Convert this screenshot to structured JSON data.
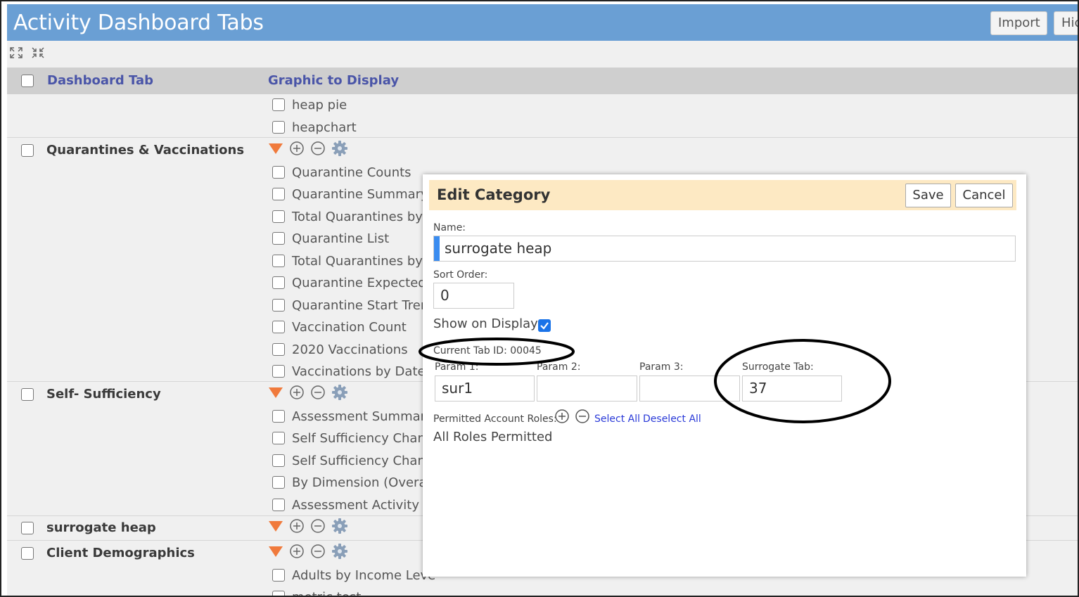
{
  "header": {
    "title": "Activity Dashboard Tabs",
    "import_label": "Import",
    "hide_label": "Hic"
  },
  "toolbar": {
    "expand_icon": "expand-all-icon",
    "collapse_icon": "collapse-all-icon"
  },
  "columns": {
    "tab": "Dashboard Tab",
    "graphic": "Graphic to Display"
  },
  "top_items": [
    "heap pie",
    "heapchart"
  ],
  "categories": [
    {
      "name": "Quarantines & Vaccinations",
      "items": [
        "Quarantine Counts",
        "Quarantine Summary I",
        "Total Quarantines by T",
        "Quarantine List",
        "Total Quarantines by S",
        "Quarantine Expected F",
        "Quarantine Start Trend",
        "Vaccination Count",
        "2020 Vaccinations",
        "Vaccinations by Date"
      ]
    },
    {
      "name": "Self- Sufficiency",
      "items": [
        "Assessment Summary",
        "Self Sufficiency Chang",
        "Self Sufficiency Chang",
        "By Dimension (Overall)",
        "Assessment Activity (A"
      ]
    },
    {
      "name": "surrogate heap",
      "items": []
    },
    {
      "name": "Client Demographics",
      "items": [
        "Adults by Income Leve",
        "metric test"
      ]
    }
  ],
  "row_icons": [
    "expand-triangle-icon",
    "add-circle-icon",
    "remove-circle-icon",
    "gear-icon"
  ],
  "dialog": {
    "title": "Edit Category",
    "save_label": "Save",
    "cancel_label": "Cancel",
    "name_label": "Name:",
    "name_value": "surrogate heap",
    "sort_label": "Sort Order:",
    "sort_value": "0",
    "show_label": "Show on Display:",
    "show_checked": true,
    "tab_id_text": "Current Tab ID: 00045",
    "param1_label": "Param 1:",
    "param1_value": "sur1",
    "param2_label": "Param 2:",
    "param2_value": "",
    "param3_label": "Param 3:",
    "param3_value": "",
    "surrogate_label": "Surrogate Tab:",
    "surrogate_value": "37",
    "roles_label": "Permitted Account Roles:",
    "select_all": "Select All",
    "deselect_all": "Deselect All",
    "roles_text": "All Roles Permitted"
  },
  "colors": {
    "header": "#6a9fd4",
    "dialog_header": "#fde9c3",
    "link": "#2a3ad8",
    "triangle": "#f07a3c",
    "accent": "#3a8cf0"
  }
}
